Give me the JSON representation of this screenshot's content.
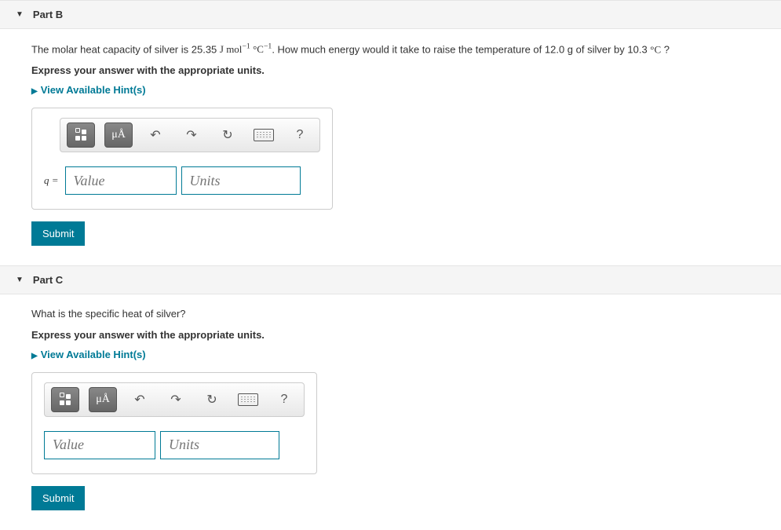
{
  "parts": [
    {
      "header": "Part B",
      "question_pre": "The molar heat capacity of silver is 25.35 ",
      "question_unit_html": "J mol<sup>−1</sup> °C<sup>−1</sup>",
      "question_mid": ". How much energy would it take to raise the temperature of 12.0 g of silver by 10.3 ",
      "question_unit2_html": "°C",
      "question_end": " ?",
      "instruction": "Express your answer with the appropriate units.",
      "hints_label": "View Available Hint(s)",
      "prefix": "q =",
      "value_placeholder": "Value",
      "units_placeholder": "Units",
      "submit_label": "Submit"
    },
    {
      "header": "Part C",
      "question_plain": "What is the specific heat of silver?",
      "instruction": "Express your answer with the appropriate units.",
      "hints_label": "View Available Hint(s)",
      "prefix": "",
      "value_placeholder": "Value",
      "units_placeholder": "Units",
      "submit_label": "Submit"
    }
  ],
  "toolbar": {
    "template_label": "template",
    "units_symbol": "μÅ",
    "undo": "undo",
    "redo": "redo",
    "reset": "reset",
    "keyboard": "keyboard",
    "help": "?"
  }
}
